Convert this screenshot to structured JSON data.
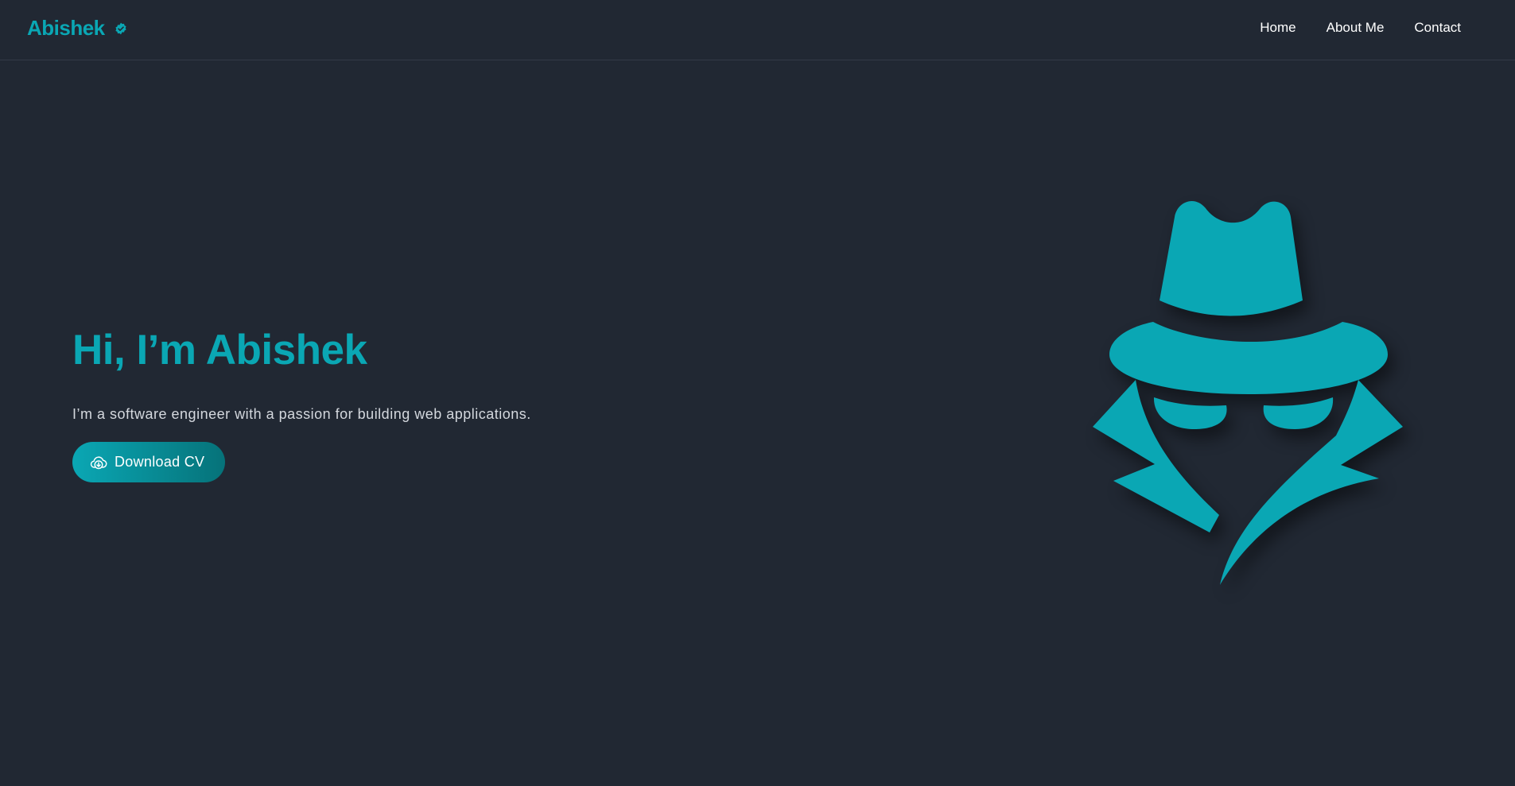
{
  "header": {
    "brand": "Abishek",
    "nav": [
      {
        "label": "Home"
      },
      {
        "label": "About Me"
      },
      {
        "label": "Contact"
      }
    ]
  },
  "hero": {
    "title": "Hi, I’m Abishek",
    "subtitle": "I’m a software engineer with a passion for building web applications.",
    "cv_button": "Download CV"
  },
  "colors": {
    "accent": "#0aa7b4",
    "background": "#212833"
  },
  "icons": {
    "brand_badge": "verified-badge-icon",
    "cv_button": "cloud-download-icon",
    "illustration": "spy-icon"
  }
}
